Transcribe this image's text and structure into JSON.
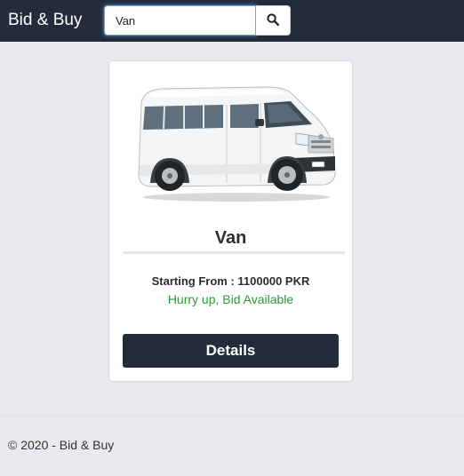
{
  "navbar": {
    "brand": "Bid & Buy",
    "search": {
      "value": "Van",
      "placeholder": ""
    },
    "search_icon": "search-icon"
  },
  "listing": {
    "title": "Van",
    "price_line": "Starting From : 1100000 PKR",
    "status": "Hurry up, Bid Available",
    "details_label": "Details",
    "image": "white-van-image"
  },
  "footer": {
    "text": "© 2020 - Bid & Buy"
  },
  "colors": {
    "navbar_bg": "#242c3c",
    "page_bg": "#e9eaed",
    "button_bg": "#242c3c",
    "status_green": "#2e9a3b",
    "focus_blue": "#6aa9e9"
  }
}
